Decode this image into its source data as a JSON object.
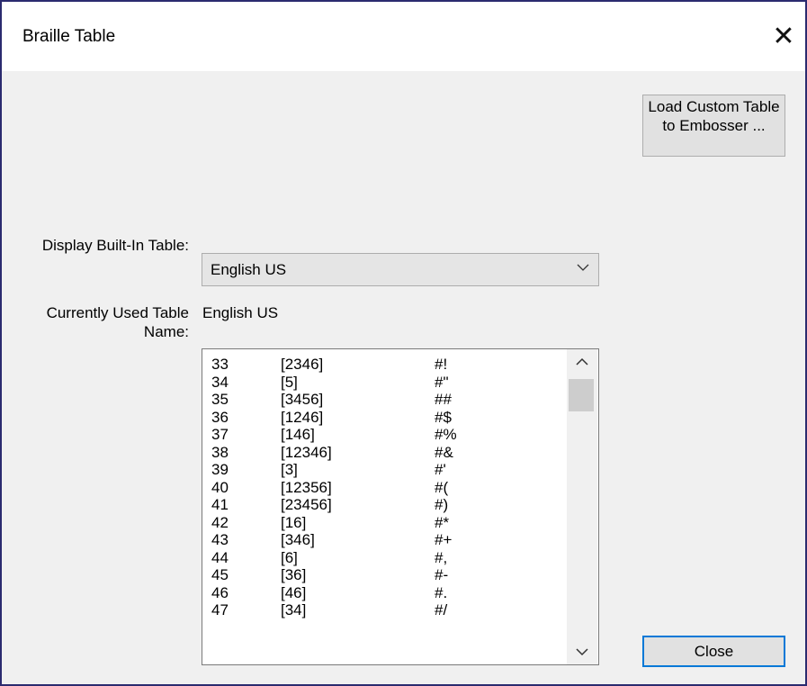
{
  "window": {
    "title": "Braille Table",
    "close_glyph": "✕"
  },
  "buttons": {
    "load_custom_label": "Load Custom Table to Embosser ...",
    "close_label": "Close"
  },
  "display_builtin": {
    "label": "Display Built-In Table:",
    "selected": "English US"
  },
  "current_table": {
    "label": "Currently Used Table Name:",
    "value": "English US"
  },
  "braille_list": {
    "rows": [
      {
        "code": "33",
        "dots": "[2346]",
        "chars": "#!"
      },
      {
        "code": "34",
        "dots": "[5]",
        "chars": "#\""
      },
      {
        "code": "35",
        "dots": "[3456]",
        "chars": "##"
      },
      {
        "code": "36",
        "dots": "[1246]",
        "chars": "#$"
      },
      {
        "code": "37",
        "dots": "[146]",
        "chars": "#%"
      },
      {
        "code": "38",
        "dots": "[12346]",
        "chars": "#&"
      },
      {
        "code": "39",
        "dots": "[3]",
        "chars": "#'"
      },
      {
        "code": "40",
        "dots": "[12356]",
        "chars": "#("
      },
      {
        "code": "41",
        "dots": "[23456]",
        "chars": "#)"
      },
      {
        "code": "42",
        "dots": "[16]",
        "chars": "#*"
      },
      {
        "code": "43",
        "dots": "[346]",
        "chars": "#+"
      },
      {
        "code": "44",
        "dots": "[6]",
        "chars": "#,"
      },
      {
        "code": "45",
        "dots": "[36]",
        "chars": "#-"
      },
      {
        "code": "46",
        "dots": "[46]",
        "chars": "#."
      },
      {
        "code": "47",
        "dots": "[34]",
        "chars": "#/"
      }
    ]
  },
  "icons": {
    "dropdown": "chevron-down-icon",
    "scroll_up": "scroll-up-arrow-icon",
    "scroll_down": "scroll-down-arrow-icon"
  },
  "colors": {
    "window_border": "#2b2b6f",
    "focus_border": "#0078d7",
    "dialog_bg": "#f0f0f0"
  }
}
